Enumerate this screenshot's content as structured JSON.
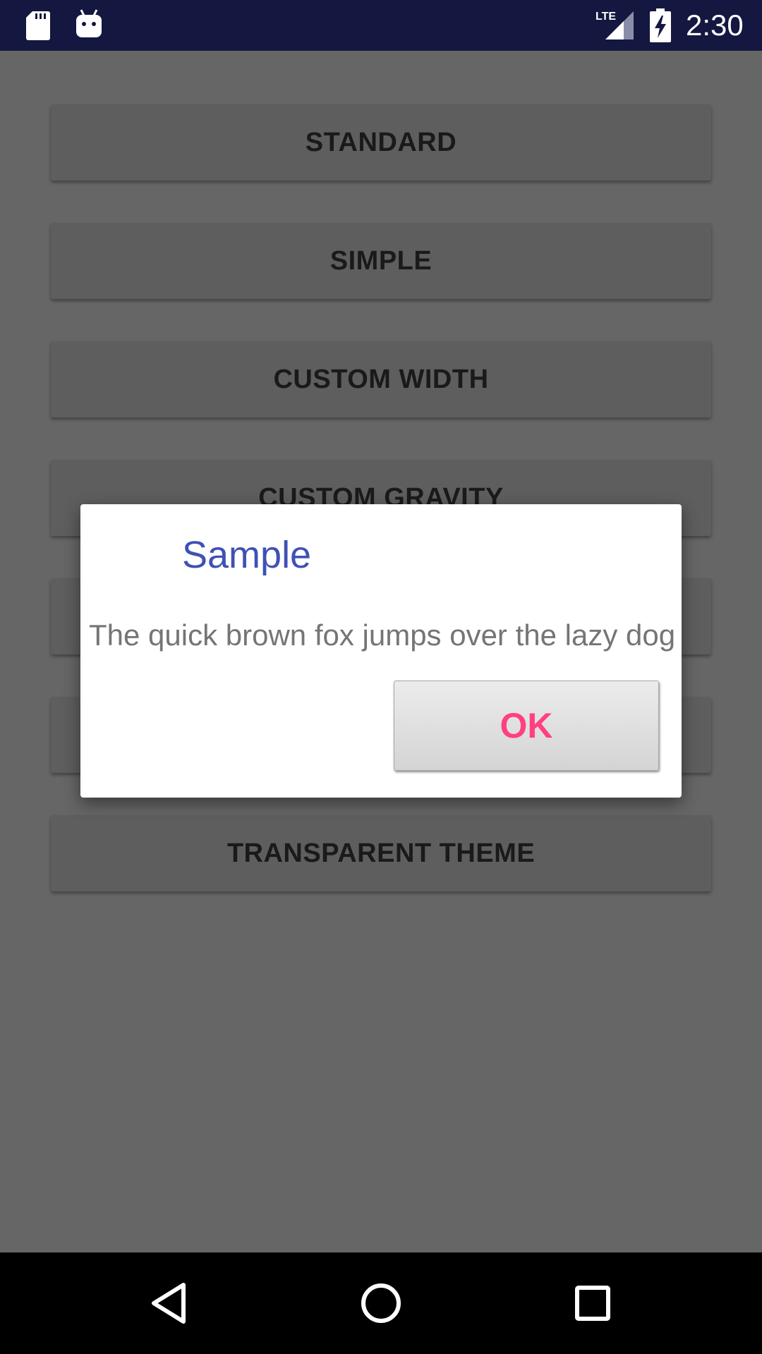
{
  "status_bar": {
    "time": "2:30",
    "network_label": "LTE",
    "icons": [
      "sd-card-icon",
      "android-debug-icon",
      "lte-signal-icon",
      "battery-charging-icon"
    ]
  },
  "buttons": [
    {
      "label": "STANDARD"
    },
    {
      "label": "SIMPLE"
    },
    {
      "label": "CUSTOM WIDTH"
    },
    {
      "label": "CUSTOM GRAVITY"
    },
    {
      "label": ""
    },
    {
      "label": ""
    },
    {
      "label": "TRANSPARENT THEME"
    }
  ],
  "dialog": {
    "title": "Sample",
    "message": "The quick brown fox jumps over the lazy dog",
    "ok_label": "OK"
  },
  "nav_bar": {
    "icons": [
      "back-icon",
      "home-icon",
      "recents-icon"
    ]
  },
  "colors": {
    "status_bar": "#141740",
    "scrim_background": "#666666",
    "dialog_title": "#3f51b5",
    "dialog_message": "#757575",
    "ok_text": "#ff4081"
  }
}
